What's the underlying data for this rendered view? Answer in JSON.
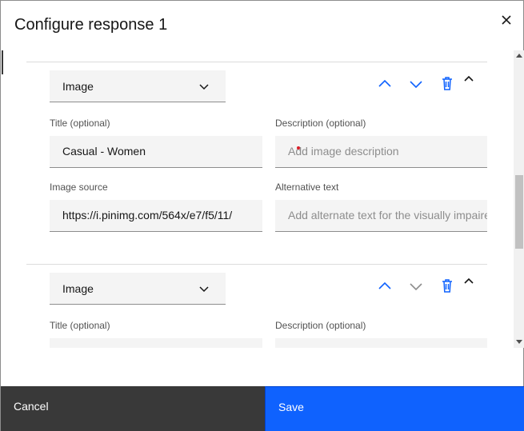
{
  "dialog": {
    "title": "Configure response 1"
  },
  "colors": {
    "primary": "#0f62fe",
    "secondary": "#393939",
    "field_bg": "#f4f4f4"
  },
  "responses": [
    {
      "type": "Image",
      "title_label": "Title (optional)",
      "title_value": "Casual - Women",
      "description_label": "Description (optional)",
      "description_placeholder": "Add image description",
      "source_label": "Image source",
      "source_value": "https://i.pinimg.com/564x/e7/f5/11/",
      "alt_label": "Alternative text",
      "alt_placeholder": "Add alternate text for the visually impaired"
    },
    {
      "type": "Image",
      "title_label": "Title (optional)",
      "description_label": "Description (optional)"
    }
  ],
  "footer": {
    "cancel_label": "Cancel",
    "save_label": "Save"
  }
}
